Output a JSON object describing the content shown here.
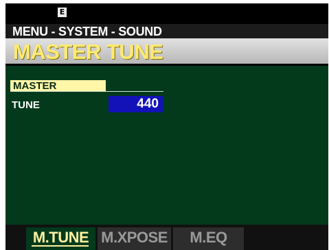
{
  "status": {
    "mode_badge": "E"
  },
  "breadcrumb": "MENU - SYSTEM - SOUND",
  "title": "MASTER TUNE",
  "parameter": {
    "header": "MASTER",
    "label": "TUNE",
    "value": "440"
  },
  "tabs": [
    {
      "label": "M.TUNE",
      "active": true
    },
    {
      "label": "M.XPOSE",
      "active": false
    },
    {
      "label": "M.EQ",
      "active": false
    }
  ],
  "colors": {
    "background": "#043a1c",
    "title_text": "#ffea70",
    "value_highlight": "#1212b8",
    "header_highlight": "#fff6a8"
  }
}
